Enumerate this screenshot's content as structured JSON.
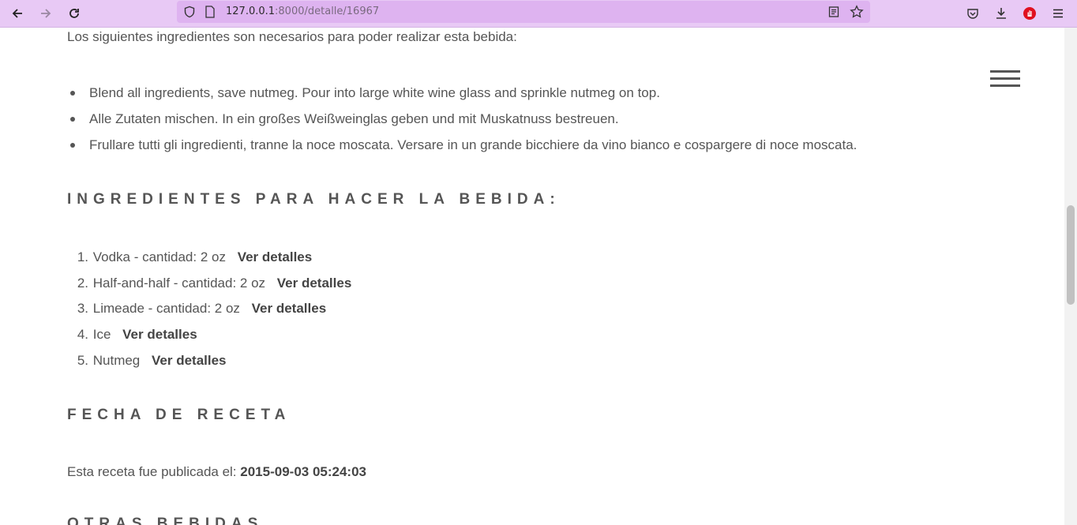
{
  "browser": {
    "url_host": "127.0.0.1",
    "url_path": ":8000/detalle/16967"
  },
  "page": {
    "intro_text": "Los siguientes ingredientes son necesarios para poder realizar esta bebida:",
    "instructions": [
      "Blend all ingredients, save nutmeg. Pour into large white wine glass and sprinkle nutmeg on top.",
      "Alle Zutaten mischen. In ein großes Weißweinglas geben und mit Muskatnuss bestreuen.",
      "Frullare tutti gli ingredienti, tranne la noce moscata. Versare in un grande bicchiere da vino bianco e cospargere di noce moscata."
    ],
    "ingredients_title": "INGREDIENTES PARA HACER LA BEBIDA:",
    "ingredients": [
      {
        "num": "1.",
        "text": "Vodka - cantidad: 2 oz",
        "link": "Ver detalles"
      },
      {
        "num": "2.",
        "text": "Half-and-half - cantidad: 2 oz",
        "link": "Ver detalles"
      },
      {
        "num": "3.",
        "text": "Limeade - cantidad: 2 oz",
        "link": "Ver detalles"
      },
      {
        "num": "4.",
        "text": "Ice",
        "link": "Ver detalles"
      },
      {
        "num": "5.",
        "text": "Nutmeg",
        "link": "Ver detalles"
      }
    ],
    "date_title": "FECHA DE RECETA",
    "published_label": "Esta receta fue publicada el:",
    "published_date": "2015-09-03 05:24:03",
    "other_title": "OTRAS BEBIDAS"
  }
}
